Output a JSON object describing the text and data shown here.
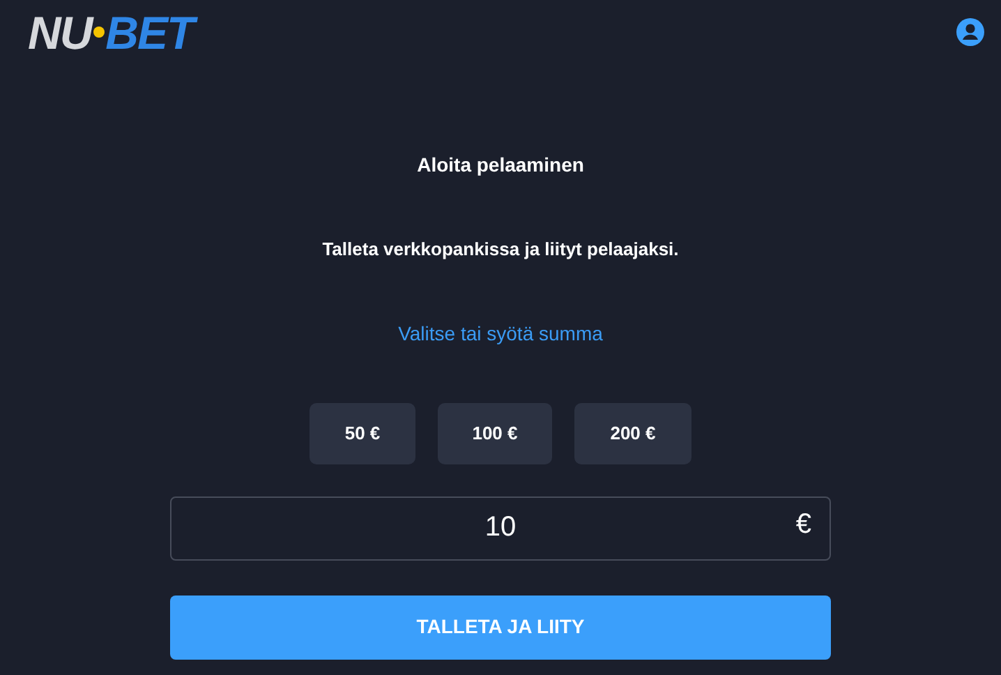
{
  "logo": {
    "first": "NU",
    "second": "BET"
  },
  "title": "Aloita pelaaminen",
  "subtitle": "Talleta verkkopankissa ja liityt pelaajaksi.",
  "prompt_link": "Valitse tai syötä summa",
  "amounts": [
    {
      "label": "50 €",
      "selected": false
    },
    {
      "label": "100 €",
      "selected": false
    },
    {
      "label": "200 €",
      "selected": false
    }
  ],
  "amount_field": {
    "value": "10",
    "currency": "€"
  },
  "submit_button": "TALLETA JA LIITY"
}
